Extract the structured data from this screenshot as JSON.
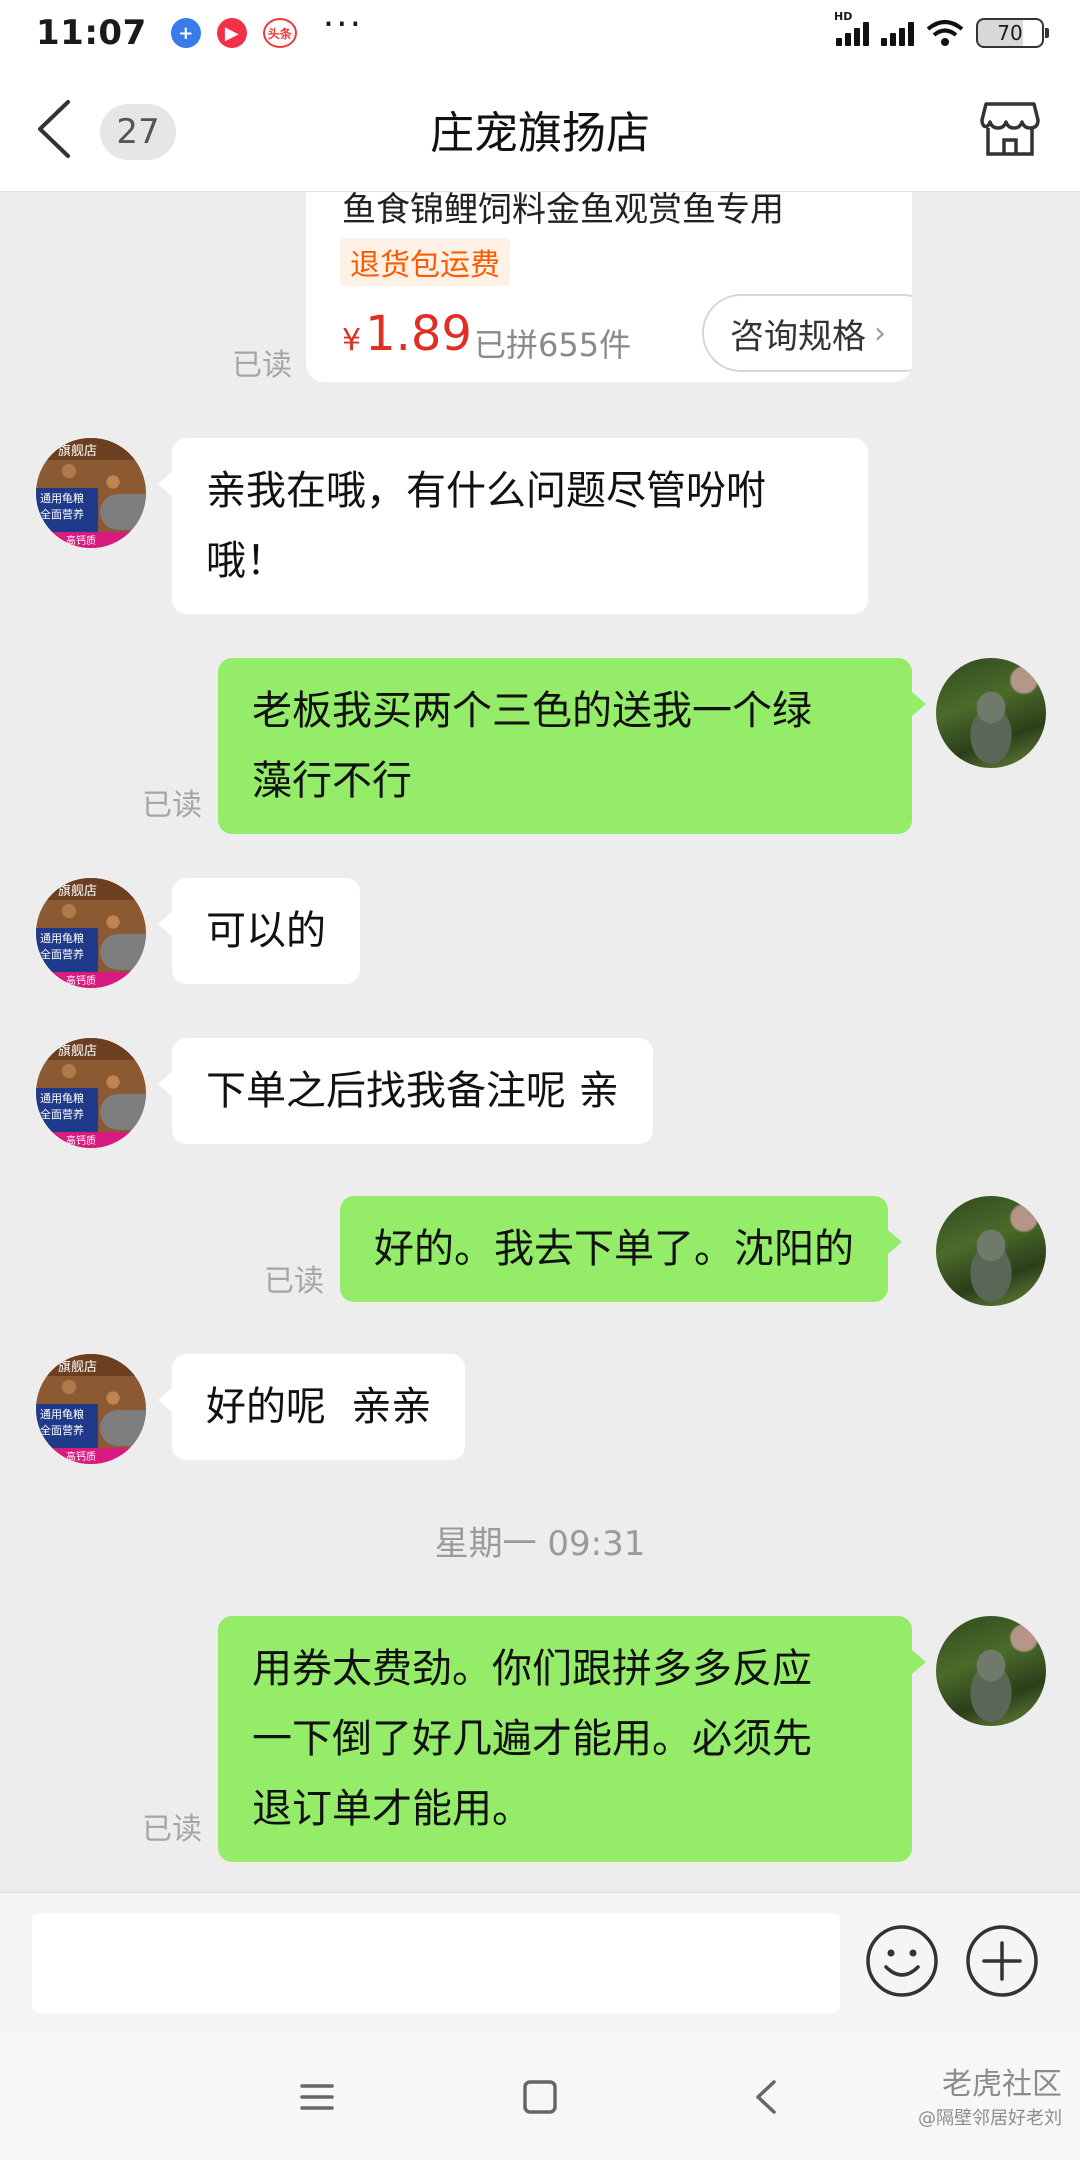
{
  "status_bar": {
    "time": "11:07",
    "icons": [
      "app-plus-icon",
      "video-icon",
      "toutiao-icon",
      "more-dots-icon"
    ],
    "toutiao_label": "头条",
    "more": "···",
    "hd_label": "HD",
    "battery": "70"
  },
  "header": {
    "back_icon": "chevron-left-icon",
    "unread_count": "27",
    "title": "庄宠旗扬店",
    "store_icon": "store-icon"
  },
  "product_card": {
    "name": "鱼食锦鲤饲料金鱼观赏鱼专用",
    "tag": "退货包运费",
    "price_symbol": "¥",
    "price": "1.89",
    "sold": "已拼655件",
    "ask_button": "咨询规格",
    "ask_chevron": "›",
    "read_status": "已读"
  },
  "messages": [
    {
      "side": "left",
      "text_lines": [
        "亲我在哦，有什么问题尽管吩咐",
        "哦！"
      ]
    },
    {
      "side": "right",
      "text_lines": [
        "老板我买两个三色的送我一个绿",
        "藻行不行"
      ],
      "read_status": "已读"
    },
    {
      "side": "left",
      "text_lines": [
        "可以的"
      ]
    },
    {
      "side": "left",
      "text_lines": [
        "下单之后找我备注呢 亲"
      ]
    },
    {
      "side": "right",
      "text_lines": [
        "好的。我去下单了。沈阳的"
      ],
      "read_status": "已读"
    },
    {
      "side": "left",
      "text_lines": [
        "好的呢  亲亲"
      ]
    },
    {
      "side": "right",
      "text_lines": [
        "用券太费劲。你们跟拼多多反应",
        "一下倒了好几遍才能用。必须先",
        "退订单才能用。"
      ],
      "read_status": "已读"
    }
  ],
  "timestamp": "星期一 09:31",
  "input_bar": {
    "placeholder": "",
    "emoji_icon": "emoji-smile-icon",
    "plus_icon": "plus-circle-icon"
  },
  "nav_bar": {
    "icons": [
      "menu-icon",
      "home-square-icon",
      "back-icon"
    ],
    "watermark": "老虎社区",
    "watermark_sub": "@隔壁邻居好老刘"
  },
  "colors": {
    "right_bubble": "#95ec69",
    "left_bubble": "#ffffff",
    "background": "#ededed",
    "price_red": "#e02e24",
    "tag_orange": "#ff5a00"
  }
}
